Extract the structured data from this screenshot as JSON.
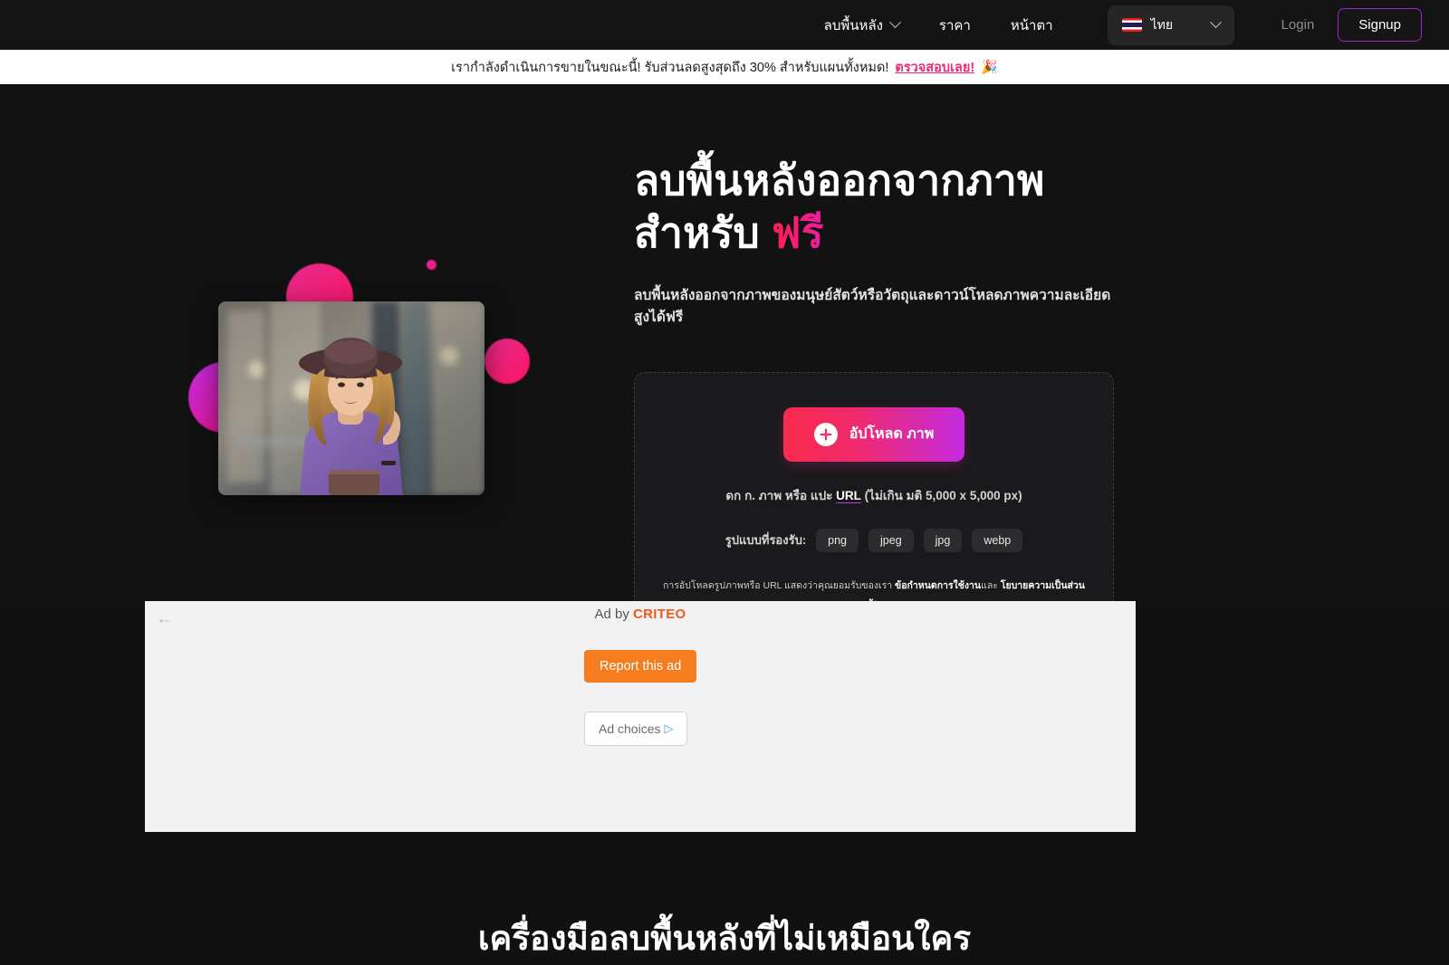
{
  "nav": {
    "items": [
      {
        "label": "ลบพื้นหลัง",
        "has_dropdown": true,
        "icon": "chevron-down-icon"
      },
      {
        "label": "ราคา",
        "has_dropdown": false
      },
      {
        "label": "หน้าตา",
        "has_dropdown": false
      }
    ],
    "language": {
      "label": "ไทย",
      "flag": "thailand-flag-icon",
      "icon": "chevron-down-icon"
    },
    "login_label": "Login",
    "signup_label": "Signup",
    "signup_border_color": "#9b27c7"
  },
  "promo": {
    "text": "เรากำลังดำเนินการขายในขณะนี้! รับส่วนลดสูงสุดถึง 30% สำหรับแผนทั้งหมด!",
    "link_label": "ตรวจสอบเลย!",
    "emoji": "🎉",
    "link_color": "#ec2a7a",
    "background": "#ffffff"
  },
  "hero": {
    "title_line1": "ลบพื้นหลังออกจากภาพ",
    "title_line2_prefix": "สำหรับ ",
    "title_accent": "ฟรี",
    "accent_color": "#ff1e4f",
    "subtitle": "ลบพื้นหลังออกจากภาพของมนุษย์สัตว์หรือวัตถุและดาวน์โหลดภาพความละเอียดสูงได้ฟรี",
    "image_alt": "ผู้หญิงสวมหมวกและเสื้อสีม่วงบนถนนในเมือง"
  },
  "upload": {
    "button_label": "อัปโหลด ภาพ",
    "button_icon": "plus-icon",
    "drop_text_prefix": "ดก ก. ภาพ หรือ แปะ ",
    "drop_text_link": "URL",
    "drop_text_suffix": " (ไม่เกิน มติ 5,000 x 5,000 px)",
    "formats_label": "รูปแบบที่รองรับ:",
    "formats": [
      "png",
      "jpeg",
      "jpg",
      "webp"
    ],
    "terms_prefix": "การอัปโหลดรูปภาพหรือ URL แสดงว่าคุณยอมรับของเรา ",
    "terms_link1": "ข้อกำหนดการใช้งาน",
    "terms_middle": "และ ",
    "terms_link2": "โยบายความเป็นส่วนตัว",
    "terms_suffix": "."
  },
  "ad": {
    "back_icon": "back-arrow-icon",
    "ad_by_prefix": "Ad by ",
    "ad_by_brand": "CRITEO",
    "report_label": "Report this ad",
    "choices_label": "Ad choices",
    "choices_icon": "adchoices-icon",
    "brand_color": "#f1581f",
    "report_color": "#f57c1f"
  },
  "bottom": {
    "title": "เครื่องมือลบพื้นหลังที่ไม่เหมือนใคร"
  }
}
